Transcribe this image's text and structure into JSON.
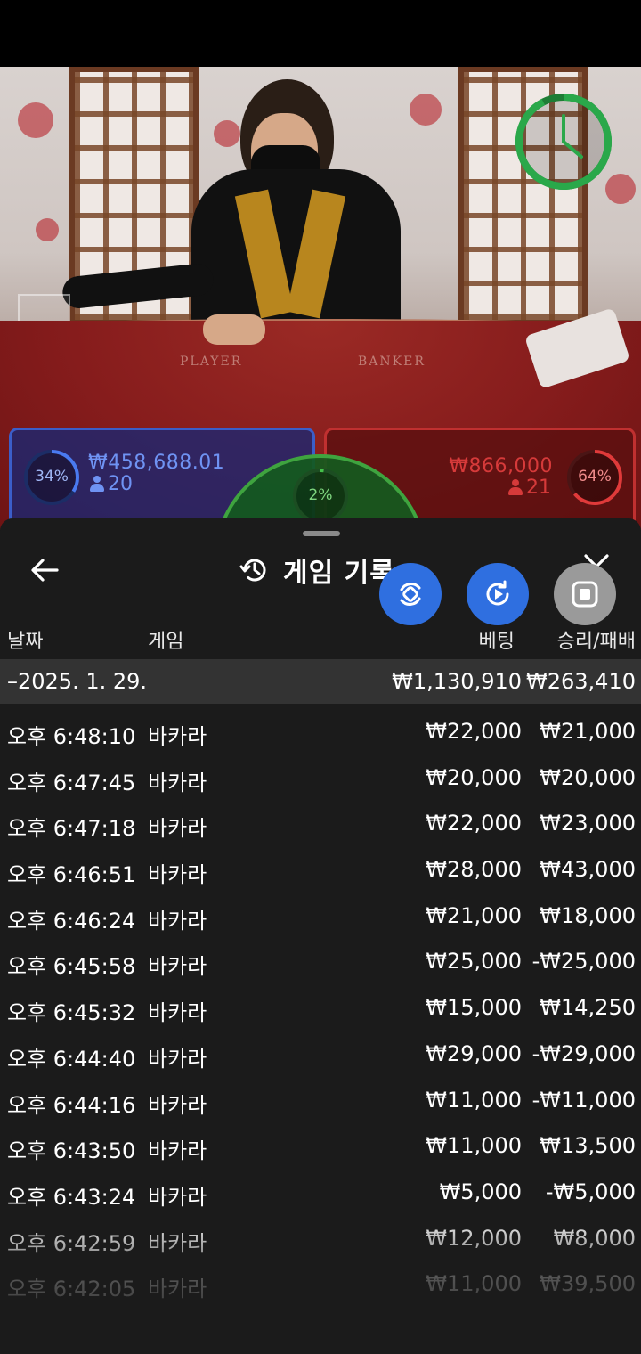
{
  "table": {
    "player_label": "PLAYER",
    "banker_label": "BANKER"
  },
  "player": {
    "percent_label": "34%",
    "percent_value": 34,
    "amount": "₩458,688.01",
    "count": "20",
    "color": "#3b5ec9"
  },
  "tie": {
    "percent_label": "2%",
    "percent_value": 2,
    "color": "#3fa43f"
  },
  "banker": {
    "percent_label": "64%",
    "percent_value": 64,
    "amount": "₩866,000",
    "count": "21",
    "color": "#c03030"
  },
  "sheet": {
    "title": "게임 기록",
    "back_icon": "arrow-left-icon",
    "history_icon": "history-icon",
    "close_icon": "close-icon"
  },
  "columns": {
    "date": "날짜",
    "game": "게임",
    "bet": "베팅",
    "win_loss": "승리/패배"
  },
  "date_group": {
    "date": "–2025. 1. 29.",
    "total_bet": "₩1,130,910",
    "total_win_loss": "₩263,410"
  },
  "records": [
    {
      "time": "오후 6:48:10",
      "game": "바카라",
      "bet": "₩22,000",
      "result": "₩21,000"
    },
    {
      "time": "오후 6:47:45",
      "game": "바카라",
      "bet": "₩20,000",
      "result": "₩20,000"
    },
    {
      "time": "오후 6:47:18",
      "game": "바카라",
      "bet": "₩22,000",
      "result": "₩23,000"
    },
    {
      "time": "오후 6:46:51",
      "game": "바카라",
      "bet": "₩28,000",
      "result": "₩43,000"
    },
    {
      "time": "오후 6:46:24",
      "game": "바카라",
      "bet": "₩21,000",
      "result": "₩18,000"
    },
    {
      "time": "오후 6:45:58",
      "game": "바카라",
      "bet": "₩25,000",
      "result": "-₩25,000"
    },
    {
      "time": "오후 6:45:32",
      "game": "바카라",
      "bet": "₩15,000",
      "result": "₩14,250"
    },
    {
      "time": "오후 6:44:40",
      "game": "바카라",
      "bet": "₩29,000",
      "result": "-₩29,000"
    },
    {
      "time": "오후 6:44:16",
      "game": "바카라",
      "bet": "₩11,000",
      "result": "-₩11,000"
    },
    {
      "time": "오후 6:43:50",
      "game": "바카라",
      "bet": "₩11,000",
      "result": "₩13,500"
    },
    {
      "time": "오후 6:43:24",
      "game": "바카라",
      "bet": "₩5,000",
      "result": "-₩5,000"
    },
    {
      "time": "오후 6:42:59",
      "game": "바카라",
      "bet": "₩12,000",
      "result": "₩8,000"
    },
    {
      "time": "오후 6:42:05",
      "game": "바카라",
      "bet": "₩11,000",
      "result": "₩39,500"
    }
  ],
  "floating_buttons": [
    "rotate-sync-icon",
    "video-replay-icon",
    "stop-icon"
  ],
  "timer_color": "#2aa84a"
}
